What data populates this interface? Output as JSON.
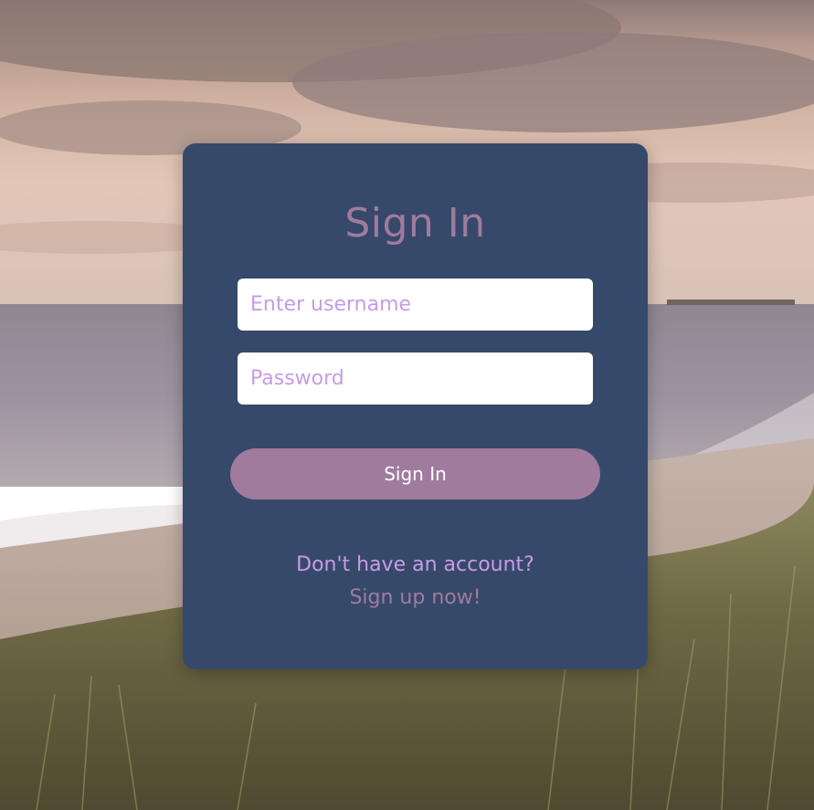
{
  "theme": {
    "card_bg": "#36496a",
    "accent": "#a07b9d",
    "placeholder": "#c99be6",
    "button_text": "#ffffff"
  },
  "background": {
    "scene": "beach-dunes-sunset-photo"
  },
  "form": {
    "title": "Sign In",
    "username": {
      "value": "",
      "placeholder": "Enter username"
    },
    "password": {
      "value": "",
      "placeholder": "Password"
    },
    "submit_label": "Sign In",
    "signup_prompt": "Don't have an account?",
    "signup_link": "Sign up now!"
  }
}
